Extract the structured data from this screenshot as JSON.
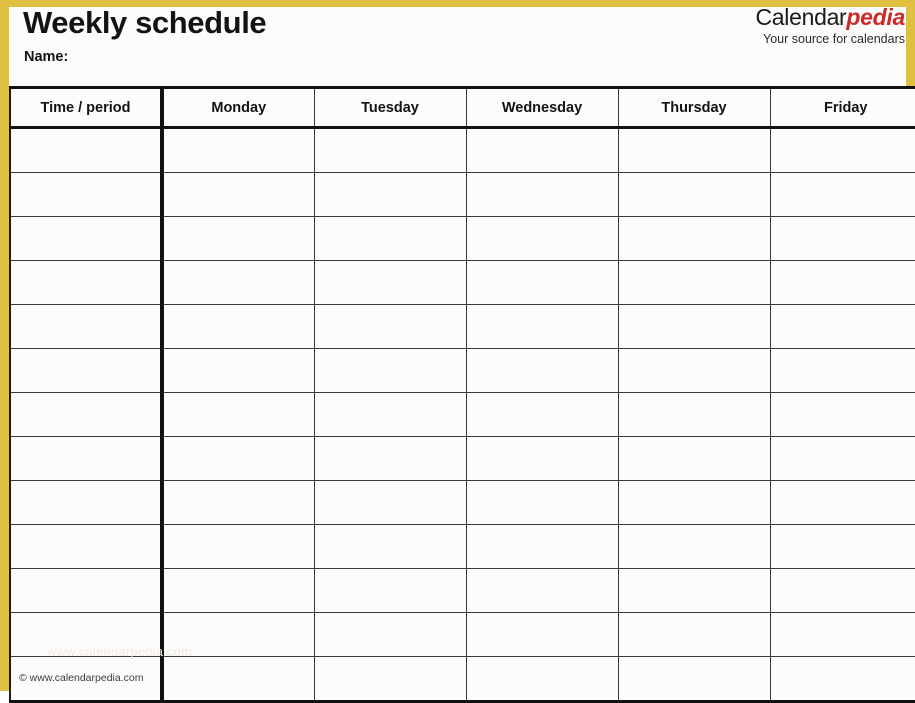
{
  "document": {
    "title": "Weekly schedule",
    "name_label": "Name:",
    "accent_color": "#e0c040",
    "page_background": "#fdfcfa",
    "grid_line_color": "#3a3a3a"
  },
  "brand": {
    "word_primary": "Calendar",
    "word_accent": "pedia",
    "accent_color": "#cc2a29",
    "tagline": "Your source for calendars"
  },
  "table": {
    "columns": [
      "Time / period",
      "Monday",
      "Tuesday",
      "Wednesday",
      "Thursday",
      "Friday"
    ],
    "row_count": 13,
    "rows": [
      [
        "",
        "",
        "",
        "",
        "",
        ""
      ],
      [
        "",
        "",
        "",
        "",
        "",
        ""
      ],
      [
        "",
        "",
        "",
        "",
        "",
        ""
      ],
      [
        "",
        "",
        "",
        "",
        "",
        ""
      ],
      [
        "",
        "",
        "",
        "",
        "",
        ""
      ],
      [
        "",
        "",
        "",
        "",
        "",
        ""
      ],
      [
        "",
        "",
        "",
        "",
        "",
        ""
      ],
      [
        "",
        "",
        "",
        "",
        "",
        ""
      ],
      [
        "",
        "",
        "",
        "",
        "",
        ""
      ],
      [
        "",
        "",
        "",
        "",
        "",
        ""
      ],
      [
        "",
        "",
        "",
        "",
        "",
        ""
      ],
      [
        "",
        "",
        "",
        "",
        "",
        ""
      ],
      [
        "",
        "",
        "",
        "",
        "",
        ""
      ]
    ]
  },
  "watermark": {
    "text": "www.calendarpedia.com"
  },
  "footer": {
    "copyright": "© www.calendarpedia.com"
  }
}
